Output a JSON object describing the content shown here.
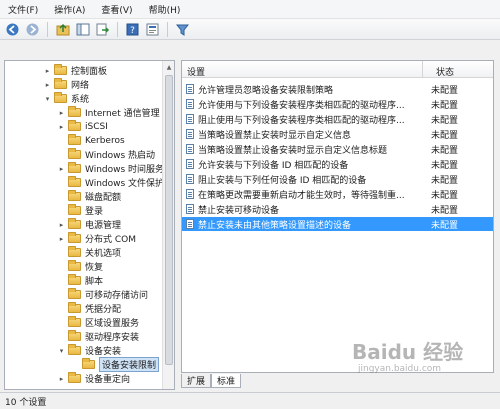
{
  "menu": [
    "文件(F)",
    "操作(A)",
    "查看(V)",
    "帮助(H)"
  ],
  "toolbar": {
    "buttons": [
      "back-arrow-icon",
      "forward-arrow-icon",
      "up-folder-icon",
      "show-tree-icon",
      "export-icon",
      "help-icon",
      "properties-icon",
      "filter-icon"
    ]
  },
  "tree": {
    "items": [
      {
        "label": "控制面板",
        "toggle": "▸"
      },
      {
        "label": "网络",
        "toggle": "▸"
      },
      {
        "label": "系统",
        "toggle": "▾"
      },
      {
        "label": "Internet 通信管理",
        "toggle": "▸"
      },
      {
        "label": "iSCSI",
        "toggle": "▸"
      },
      {
        "label": "Kerberos",
        "toggle": ""
      },
      {
        "label": "Windows 热启动",
        "toggle": ""
      },
      {
        "label": "Windows 时间服务",
        "toggle": "▸"
      },
      {
        "label": "Windows 文件保护",
        "toggle": ""
      },
      {
        "label": "磁盘配额",
        "toggle": ""
      },
      {
        "label": "登录",
        "toggle": ""
      },
      {
        "label": "电源管理",
        "toggle": "▸"
      },
      {
        "label": "分布式 COM",
        "toggle": "▸"
      },
      {
        "label": "关机选项",
        "toggle": ""
      },
      {
        "label": "恢复",
        "toggle": ""
      },
      {
        "label": "脚本",
        "toggle": ""
      },
      {
        "label": "可移动存储访问",
        "toggle": ""
      },
      {
        "label": "凭据分配",
        "toggle": ""
      },
      {
        "label": "区域设置服务",
        "toggle": ""
      },
      {
        "label": "驱动程序安装",
        "toggle": ""
      },
      {
        "label": "设备安装",
        "toggle": "▾"
      },
      {
        "label": "设备安装限制",
        "toggle": ""
      },
      {
        "label": "设备重定向",
        "toggle": "▸"
      }
    ]
  },
  "list": {
    "headers": {
      "setting": "设置",
      "status": "状态"
    },
    "rows": [
      {
        "name": "允许管理员忽略设备安装限制策略",
        "status": "未配置"
      },
      {
        "name": "允许使用与下列设备安装程序类相匹配的驱动程序...",
        "status": "未配置"
      },
      {
        "name": "阻止使用与下列设备安装程序类相匹配的驱动程序...",
        "status": "未配置"
      },
      {
        "name": "当策略设置禁止安装时显示自定义信息",
        "status": "未配置"
      },
      {
        "name": "当策略设置禁止设备安装时显示自定义信息标题",
        "status": "未配置"
      },
      {
        "name": "允许安装与下列设备 ID 相匹配的设备",
        "status": "未配置"
      },
      {
        "name": "阻止安装与下列任何设备 ID 相匹配的设备",
        "status": "未配置"
      },
      {
        "name": "在策略更改需要重新启动才能生效时，等待强制重...",
        "status": "未配置"
      },
      {
        "name": "禁止安装可移动设备",
        "status": "未配置"
      },
      {
        "name": "禁止安装未由其他策略设置描述的设备",
        "status": "未配置"
      }
    ]
  },
  "tabs": [
    "扩展",
    "标准"
  ],
  "statusbar": {
    "text": "10 个设置"
  },
  "watermark": {
    "logo": "Baidu 经验",
    "url": "jingyan.baidu.com"
  },
  "colors": {
    "selection": "#3399ff",
    "tree_selection": "#cfe3f7"
  }
}
